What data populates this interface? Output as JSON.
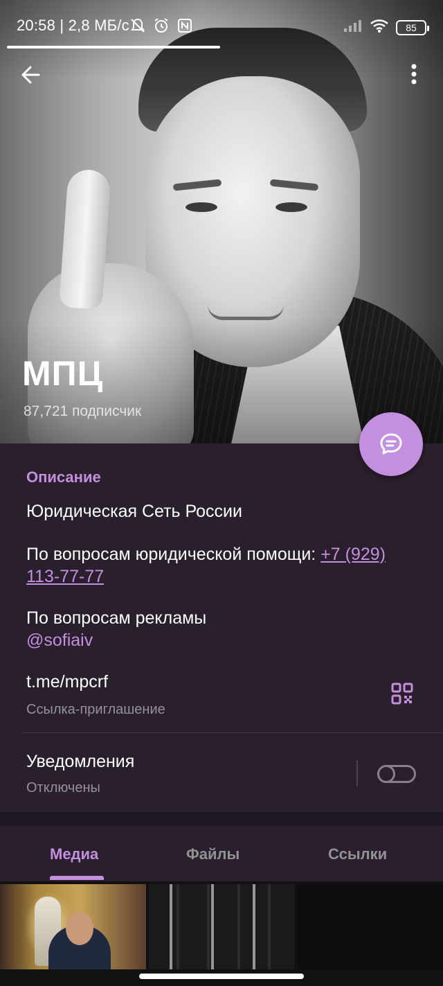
{
  "status_bar": {
    "time_speed": "20:58 | 2,8 МБ/с",
    "battery_level": "85",
    "icons": [
      "dnd-icon",
      "alarm-icon",
      "nfc-icon",
      "signal-icon",
      "wifi-icon",
      "battery-icon"
    ]
  },
  "header": {
    "back_icon": "arrow-left-icon",
    "menu_icon": "more-vertical-icon",
    "channel_name": "МПЦ",
    "subscribers": "87,721 подписчик"
  },
  "fab": {
    "icon": "chat-icon"
  },
  "info": {
    "section_title": "Описание",
    "line1": "Юридическая Сеть России",
    "legal_help_prefix": "По вопросам юридической помощи: ",
    "legal_help_phone_part1": "+7 (929) ",
    "legal_help_phone_part2": "113-77-77",
    "ads_label": "По вопросам рекламы",
    "ads_contact": "@sofiaiv",
    "invite_link": "t.me/mpcrf",
    "invite_label": "Ссылка-приглашение",
    "notifications_label": "Уведомления",
    "notifications_status": "Отключены",
    "notifications_enabled": false
  },
  "tabs": [
    {
      "label": "Медиа",
      "active": true
    },
    {
      "label": "Файлы",
      "active": false
    },
    {
      "label": "Ссылки",
      "active": false
    }
  ],
  "media_thumbnails": [
    "media-thumb-1",
    "media-thumb-2",
    "media-thumb-3"
  ],
  "colors": {
    "accent": "#c58fe0",
    "background": "#2a1f2c",
    "text": "#ffffff"
  }
}
